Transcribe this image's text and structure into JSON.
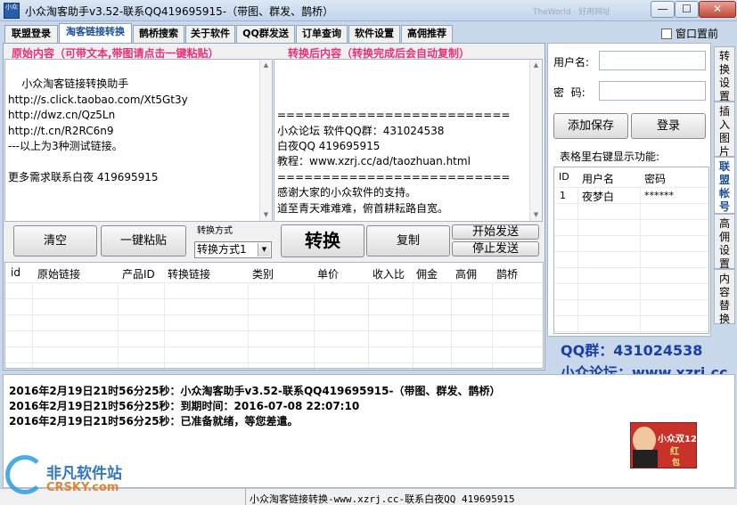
{
  "window": {
    "title": "小众淘客助手v3.52-联系QQ419695915-（带图、群发、鹊桥）",
    "ghost_text": "TheWorld · 好用网址",
    "min_label": "—",
    "max_label": "☐",
    "close_label": "✕",
    "icon_text": "小众"
  },
  "tabs": [
    "联盟登录",
    "淘客链接转换",
    "鹊桥搜索",
    "关于软件",
    "QQ群发送",
    "订单查询",
    "软件设置",
    "高佣推荐"
  ],
  "topmost_label": "窗口置前",
  "main": {
    "original_header": "原始内容（可带文本,带图请点击一键粘贴）",
    "converted_header": "转换后内容（转换完成后会自动复制）",
    "original_text": "小众淘客链接转换助手\nhttp://s.click.taobao.com/Xt5Gt3y\nhttp://dwz.cn/Qz5Ln\nhttp://t.cn/R2RC6n9\n---以上为3种测试链接。\n\n更多需求联系白夜 419695915",
    "converted_text": "\n\n==========================\n小众论坛 软件QQ群：431024538\n白夜QQ 419695915\n教程：www.xzrj.cc/ad/taozhuan.html\n==========================\n感谢大家的小众软件的支持。\n道至青天难难难，俯首耕耘路自宽。",
    "clear_label": "清空",
    "paste_label": "一键粘贴",
    "mode_caption": "转换方式",
    "mode_value": "转换方式1",
    "convert_label": "转换",
    "copy_label": "复制",
    "start_send_label": "开始发送",
    "stop_send_label": "停止发送",
    "columns": [
      "id",
      "原始链接",
      "产品ID",
      "转换链接",
      "类别",
      "单价",
      "收入比",
      "佣金",
      "高佣",
      "鹊桥"
    ]
  },
  "right": {
    "username_label": "用户名:",
    "password_label": "密  码:",
    "add_save_label": "添加保存",
    "login_label": "登录",
    "table_caption": "表格里右键显示功能:",
    "columns": [
      "ID",
      "用户名",
      "密码"
    ],
    "rows": [
      {
        "id": "1",
        "user": "夜梦白",
        "pass": "******"
      }
    ],
    "vtabs": [
      "转换设置",
      "插入图片",
      "联盟帐号",
      "高佣设置",
      "内容替换"
    ]
  },
  "promo": {
    "qq_group": "QQ群：431024538",
    "forum": "小众论坛：www.xzrj.cc"
  },
  "log": [
    "2016年2月19日21时56分25秒：小众淘客助手v3.52-联系QQ419695915-（带图、群发、鹊桥）",
    "2016年2月19日21时56分25秒：到期时间：2016-07-08 22:07:10",
    "2016年2月19日21时56分25秒：已准备就绪，等您差遣。"
  ],
  "ad_text": "小众双12",
  "ad_text2": "红",
  "ad_text3": "包",
  "status_text": "小众淘客链接转换-www.xzrj.cc-联系白夜QQ 419695915",
  "watermark": {
    "cn": "非凡软件站",
    "en": "CRSKY.com"
  },
  "colors": {
    "accent_pink": "#e8317a",
    "promo_blue": "#1a3fa3"
  }
}
